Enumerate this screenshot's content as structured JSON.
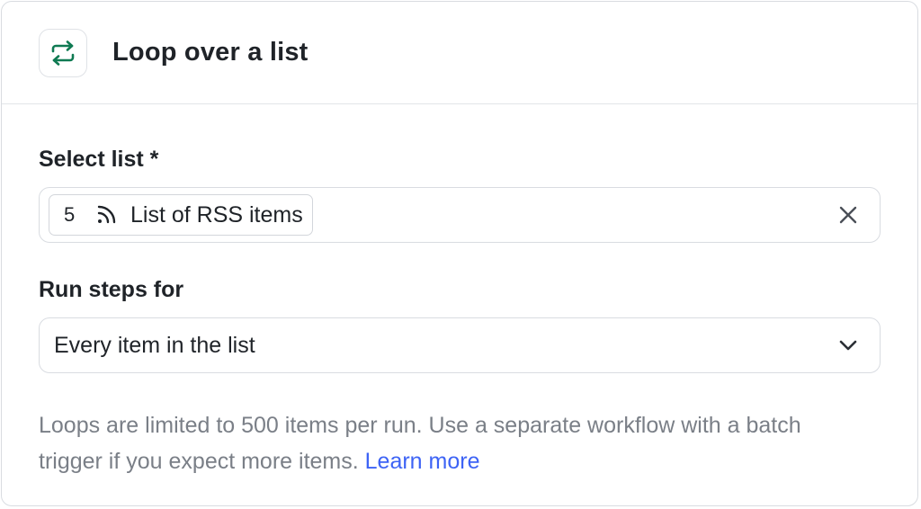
{
  "header": {
    "icon": "loop-arrows-icon",
    "title": "Loop over a list",
    "icon_color": "#0f7a52"
  },
  "list_field": {
    "label": "Select list *",
    "token": {
      "step_number": "5",
      "icon": "rss-icon",
      "label": "List of RSS items"
    },
    "clear_icon": "close-icon"
  },
  "run_field": {
    "label": "Run steps for",
    "selected": "Every item in the list",
    "chevron_icon": "chevron-down-icon"
  },
  "help": {
    "text": "Loops are limited to 500 items per run. Use a separate workflow with a batch trigger if you expect more items. ",
    "link": "Learn more",
    "link_color": "#3d63f5"
  }
}
